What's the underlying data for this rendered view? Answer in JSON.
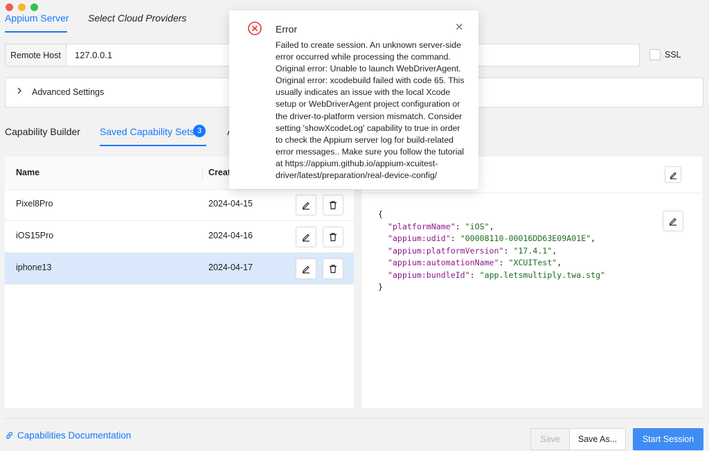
{
  "window": {
    "top_tabs": [
      {
        "label": "Appium Server"
      },
      {
        "label": "Select Cloud Providers"
      }
    ]
  },
  "server": {
    "remote_host_label": "Remote Host",
    "remote_host_value": "127.0.0.1",
    "ssl_label": "SSL",
    "advanced_settings_label": "Advanced Settings"
  },
  "capability_tabs": {
    "builder": "Capability Builder",
    "saved": "Saved Capability Sets",
    "saved_count": "3",
    "third_partial": "A"
  },
  "table": {
    "headers": [
      "Name",
      "Creat"
    ],
    "rows": [
      {
        "name": "Pixel8Pro",
        "created": "2024-04-15"
      },
      {
        "name": "iOS15Pro",
        "created": "2024-04-16"
      },
      {
        "name": "iphone13",
        "created": "2024-04-17",
        "selected": true
      }
    ]
  },
  "json_preview": {
    "open_brace": "{",
    "close_brace": "}",
    "entries": [
      {
        "key": "\"platformName\"",
        "value": "\"iOS\"",
        "trail": ","
      },
      {
        "key": "\"appium:udid\"",
        "value": "\"00008110-00016DD63E09A01E\"",
        "trail": ","
      },
      {
        "key": "\"appium:platformVersion\"",
        "value": "\"17.4.1\"",
        "trail": ","
      },
      {
        "key": "\"appium:automationName\"",
        "value": "\"XCUITest\"",
        "trail": ","
      },
      {
        "key": "\"appium:bundleId\"",
        "value": "\"app.letsmultiply.twa.stg\"",
        "trail": ""
      }
    ]
  },
  "footer": {
    "docs_link": "Capabilities Documentation",
    "save": "Save",
    "save_as": "Save As...",
    "start_session": "Start Session"
  },
  "error_modal": {
    "title": "Error",
    "message": "Failed to create session. An unknown server-side error occurred while processing the command. Original error: Unable to launch WebDriverAgent. Original error: xcodebuild failed with code 65. This usually indicates an issue with the local Xcode setup or WebDriverAgent project configuration or the driver-to-platform version mismatch. Consider setting 'showXcodeLog' capability to true in order to check the Appium server log for build-related error messages.. Make sure you follow the tutorial at https://appium.github.io/appium-xcuitest-driver/latest/preparation/real-device-config/",
    "close_glyph": "✕"
  },
  "colors": {
    "accent": "#1677ff",
    "selected_row": "#d9e8fb",
    "error": "#e53935",
    "json_key": "#8b1a8b",
    "json_string": "#1e6b1e"
  },
  "icons": {
    "traffic_lights": [
      "close-light",
      "minimize-light",
      "zoom-light"
    ],
    "row_actions": [
      "edit-icon",
      "delete-icon"
    ],
    "modal": "error-circle-icon"
  }
}
